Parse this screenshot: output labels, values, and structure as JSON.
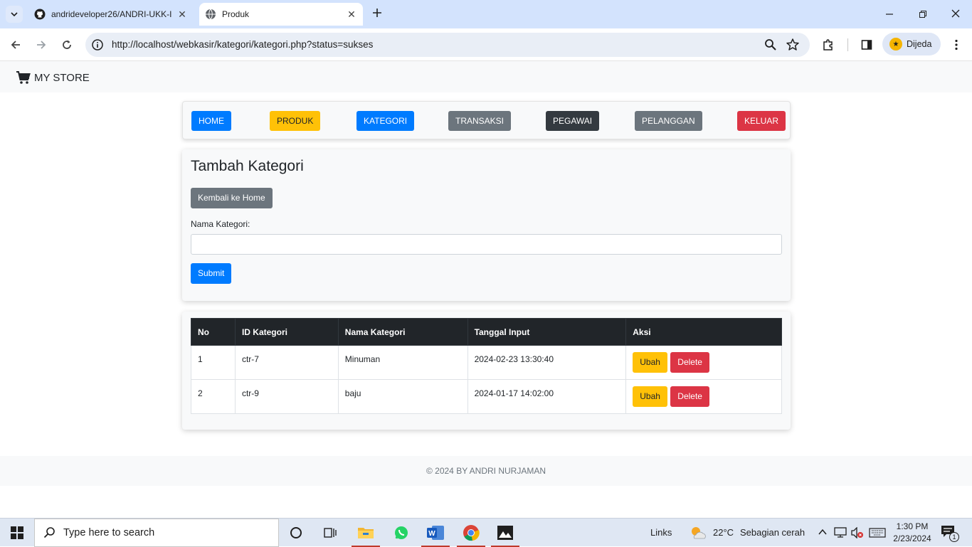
{
  "browser": {
    "tabs": [
      {
        "title": "andrideveloper26/ANDRI-UKK-I",
        "favicon": "github-icon"
      },
      {
        "title": "Produk",
        "favicon": "globe-icon"
      }
    ],
    "url": "http://localhost/webkasir/kategori/kategori.php?status=sukses",
    "profile_name": "Dijeda"
  },
  "brand": {
    "name": "MY STORE",
    "icon": "cart-icon"
  },
  "menu": [
    {
      "label": "HOME",
      "color": "#007bff"
    },
    {
      "label": "PRODUK",
      "color": "#ffc107"
    },
    {
      "label": "KATEGORI",
      "color": "#007bff"
    },
    {
      "label": "TRANSAKSI",
      "color": "#6c757d"
    },
    {
      "label": "PEGAWAI",
      "color": "#343a40"
    },
    {
      "label": "PELANGGAN",
      "color": "#6c757d"
    },
    {
      "label": "KELUAR",
      "color": "#dc3545"
    }
  ],
  "form": {
    "title": "Tambah Kategori",
    "back_label": "Kembali ke Home",
    "field_label": "Nama Kategori:",
    "field_value": "",
    "submit_label": "Submit"
  },
  "table": {
    "headers": [
      "No",
      "ID Kategori",
      "Nama Kategori",
      "Tanggal Input",
      "Aksi"
    ],
    "rows": [
      {
        "no": "1",
        "id": "ctr-7",
        "nama": "Minuman",
        "tanggal": "2024-02-23 13:30:40"
      },
      {
        "no": "2",
        "id": "ctr-9",
        "nama": "baju",
        "tanggal": "2024-01-17 14:02:00"
      }
    ],
    "edit_label": "Ubah",
    "delete_label": "Delete"
  },
  "footer": {
    "text": "© 2024 BY ANDRI NURJAMAN"
  },
  "taskbar": {
    "search_placeholder": "Type here to search",
    "links_label": "Links",
    "weather_temp": "22°C",
    "weather_desc": "Sebagian cerah",
    "time": "1:30 PM",
    "date": "2/23/2024",
    "notification_count": "1"
  }
}
